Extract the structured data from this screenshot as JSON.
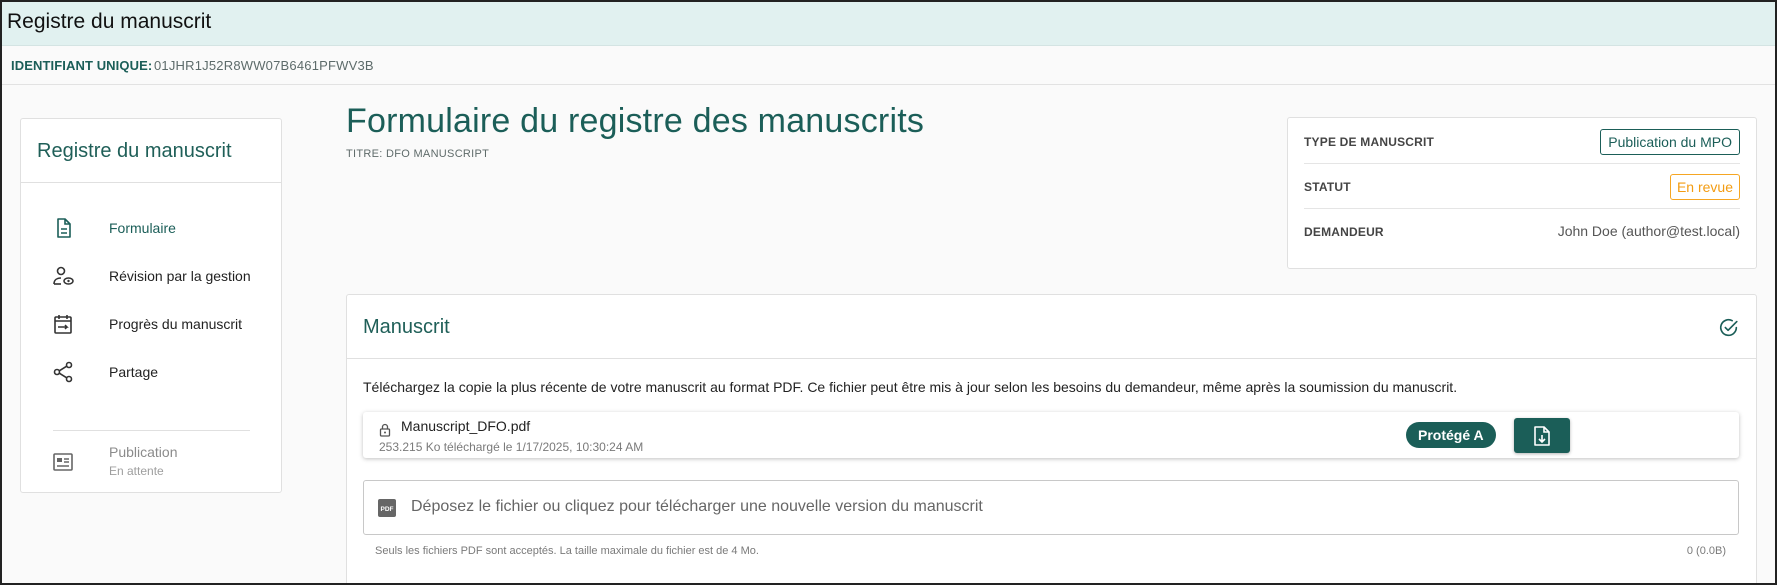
{
  "window": {
    "title": "Registre du manuscrit"
  },
  "id_bar": {
    "label": "IDENTIFIANT UNIQUE:",
    "value": "01JHR1J52R8WW07B6461PFWV3B"
  },
  "sidebar": {
    "title": "Registre du manuscrit",
    "items": [
      {
        "label": "Formulaire",
        "icon": "document-icon",
        "active": true
      },
      {
        "label": "Révision par la gestion",
        "icon": "person-review-icon"
      },
      {
        "label": "Progrès du manuscrit",
        "icon": "calendar-progress-icon"
      },
      {
        "label": "Partage",
        "icon": "share-icon"
      },
      {
        "label": "Publication",
        "sublabel": "En attente",
        "icon": "article-icon",
        "disabled": true
      }
    ]
  },
  "page": {
    "title": "Formulaire du registre des manuscrits",
    "subtitle": "TITRE: DFO MANUSCRIPT"
  },
  "info": {
    "type_label": "TYPE DE MANUSCRIT",
    "type_value": "Publication du MPO",
    "status_label": "STATUT",
    "status_value": "En revue",
    "requester_label": "DEMANDEUR",
    "requester_value": "John Doe (author@test.local)"
  },
  "manuscript": {
    "title": "Manuscrit",
    "description": "Téléchargez la copie la plus récente de votre manuscrit au format PDF. Ce fichier peut être mis à jour selon les besoins du demandeur, même après la soumission du manuscrit.",
    "file": {
      "name": "Manuscript_DFO.pdf",
      "meta": "253.215 Ko téléchargé le 1/17/2025, 10:30:24 AM",
      "classification": "Protégé A"
    },
    "dropzone": "Déposez le fichier ou cliquez pour télécharger une nouvelle version du manuscrit",
    "hint": "Seuls les fichiers PDF sont acceptés. La taille maximale du fichier est de 4 Mo.",
    "counter": "0 (0.0B)"
  },
  "colors": {
    "primary": "#1b5e58",
    "header_bg": "#e1f1f0",
    "warning": "#f39c12"
  }
}
